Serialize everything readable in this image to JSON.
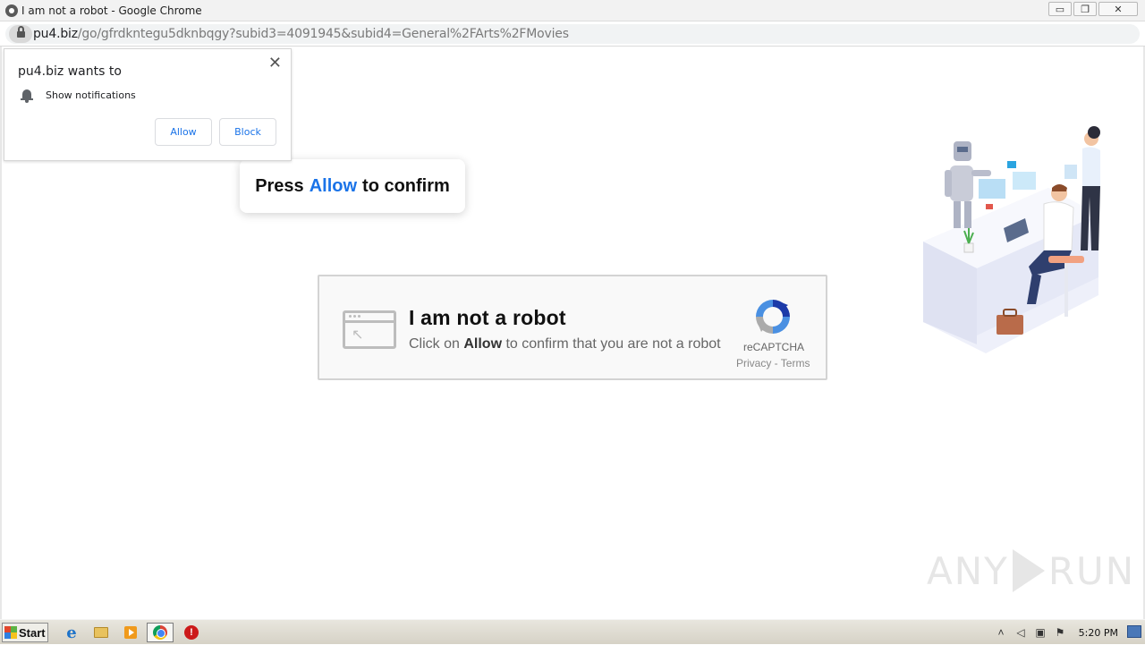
{
  "window": {
    "title": "I am not a robot - Google Chrome",
    "controls": {
      "minimize": "▭",
      "restore": "❐",
      "close": "✕"
    }
  },
  "address_bar": {
    "host": "pu4.biz",
    "path": "/go/gfrdkntegu5dknbqgy?subid3=4091945&subid4=General%2FArts%2FMovies"
  },
  "notification_prompt": {
    "title": "pu4.biz wants to",
    "permission": "Show notifications",
    "allow_label": "Allow",
    "block_label": "Block",
    "close_glyph": "✕"
  },
  "tooltip": {
    "prefix": "Press",
    "accent": "Allow",
    "suffix": "to confirm",
    "accent_color": "#1a73e8"
  },
  "captcha": {
    "title": "I am not a robot",
    "subtitle_prefix": "Click on",
    "subtitle_bold": "Allow",
    "subtitle_suffix": "to confirm that you are not a robot",
    "brand": "reCAPTCHA",
    "links": "Privacy - Terms"
  },
  "watermark": {
    "left": "ANY",
    "right": "RUN"
  },
  "taskbar": {
    "start_label": "Start",
    "ie_glyph": "e",
    "stop_glyph": "!",
    "clock": "5:20 PM",
    "tray_icons": [
      "chevron-up-icon",
      "speaker-icon",
      "network-icon",
      "flag-icon"
    ]
  }
}
